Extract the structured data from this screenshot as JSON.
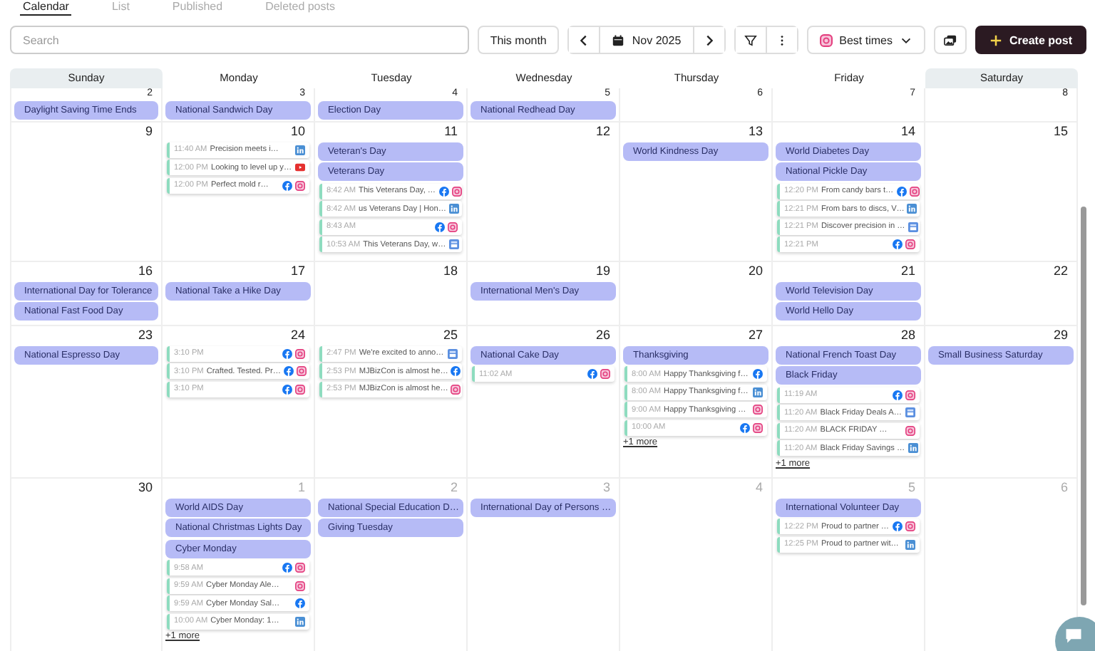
{
  "tabs": [
    {
      "label": "Calendar",
      "selected": true
    },
    {
      "label": "List",
      "selected": false
    },
    {
      "label": "Published",
      "selected": false
    },
    {
      "label": "Deleted posts",
      "selected": false
    }
  ],
  "toolbar": {
    "search": {
      "placeholder": "Search"
    },
    "this_month": "This month",
    "month": "Nov 2025",
    "best_times": "Best times",
    "create_post": "Create post"
  },
  "weekdays": [
    {
      "label": "Sunday",
      "weekend": true
    },
    {
      "label": "Monday",
      "weekend": false
    },
    {
      "label": "Tuesday",
      "weekend": false
    },
    {
      "label": "Wednesday",
      "weekend": false
    },
    {
      "label": "Thursday",
      "weekend": false
    },
    {
      "label": "Friday",
      "weekend": false
    },
    {
      "label": "Saturday",
      "weekend": true
    }
  ],
  "weeks": [
    {
      "days": [
        {
          "date": "2",
          "muted": false,
          "events": [
            "Daylight Saving Time Ends"
          ]
        },
        {
          "date": "3",
          "muted": false,
          "events": [
            "National Sandwich Day"
          ]
        },
        {
          "date": "4",
          "muted": false,
          "events": [
            "Election Day"
          ]
        },
        {
          "date": "5",
          "muted": false,
          "events": [
            "National Redhead Day"
          ]
        },
        {
          "date": "6",
          "muted": false
        },
        {
          "date": "7",
          "muted": false
        },
        {
          "date": "8",
          "muted": false
        }
      ]
    },
    {
      "days": [
        {
          "date": "9",
          "muted": false
        },
        {
          "date": "10",
          "muted": false,
          "posts": [
            {
              "time": "11:40 AM",
              "text": "Precision meets i…",
              "networks": [
                {
                  "kind": "linkedin"
                }
              ]
            },
            {
              "time": "12:00 PM",
              "text": "Looking to level up y…",
              "networks": [
                {
                  "kind": "youtube"
                }
              ]
            },
            {
              "time": "12:00 PM",
              "text": "Perfect mold r…",
              "networks": [
                {
                  "kind": "facebook"
                },
                {
                  "kind": "instagram"
                }
              ]
            }
          ]
        },
        {
          "date": "11",
          "muted": false,
          "events": [
            "Veteran's Day",
            "Veterans Day"
          ],
          "posts": [
            {
              "time": "8:42 AM",
              "text": "This Veterans Day, …",
              "networks": [
                {
                  "kind": "facebook"
                },
                {
                  "kind": "instagram"
                }
              ]
            },
            {
              "time": "8:42 AM",
              "text": "us Veterans Day | Hon…",
              "networks": [
                {
                  "kind": "linkedin"
                }
              ]
            },
            {
              "time": "8:43 AM",
              "networks": [
                {
                  "kind": "facebook"
                },
                {
                  "kind": "instagram"
                }
              ]
            },
            {
              "time": "10:53 AM",
              "text": "This Veterans Day, w…",
              "networks": [
                {
                  "kind": "business"
                }
              ]
            }
          ]
        },
        {
          "date": "12",
          "muted": false
        },
        {
          "date": "13",
          "muted": false,
          "events": [
            "World Kindness Day"
          ]
        },
        {
          "date": "14",
          "muted": false,
          "events": [
            "World Diabetes Day",
            "National Pickle Day"
          ],
          "posts": [
            {
              "time": "12:20 PM",
              "text": "From candy bars t…",
              "networks": [
                {
                  "kind": "facebook"
                },
                {
                  "kind": "instagram"
                }
              ]
            },
            {
              "time": "12:21 PM",
              "text": "From bars to discs, V…",
              "networks": [
                {
                  "kind": "linkedin"
                }
              ]
            },
            {
              "time": "12:21 PM",
              "text": "Discover precision in …",
              "networks": [
                {
                  "kind": "business"
                }
              ]
            },
            {
              "time": "12:21 PM",
              "networks": [
                {
                  "kind": "facebook"
                },
                {
                  "kind": "instagram"
                }
              ]
            }
          ]
        },
        {
          "date": "15",
          "muted": false
        }
      ]
    },
    {
      "days": [
        {
          "date": "16",
          "muted": false,
          "events": [
            "International Day for Tolerance",
            "National Fast Food Day"
          ]
        },
        {
          "date": "17",
          "muted": false,
          "events": [
            "National Take a Hike Day"
          ]
        },
        {
          "date": "18",
          "muted": false
        },
        {
          "date": "19",
          "muted": false,
          "events": [
            "International Men's Day"
          ]
        },
        {
          "date": "20",
          "muted": false
        },
        {
          "date": "21",
          "muted": false,
          "events": [
            "World Television Day",
            "World Hello Day"
          ]
        },
        {
          "date": "22",
          "muted": false
        }
      ]
    },
    {
      "days": [
        {
          "date": "23",
          "muted": false,
          "events": [
            "National Espresso Day"
          ]
        },
        {
          "date": "24",
          "muted": false,
          "posts": [
            {
              "time": "3:10 PM",
              "networks": [
                {
                  "kind": "facebook"
                },
                {
                  "kind": "instagram"
                }
              ]
            },
            {
              "time": "3:10 PM",
              "text": "Crafted. Tested. Pr…",
              "networks": [
                {
                  "kind": "facebook"
                },
                {
                  "kind": "instagram"
                }
              ]
            },
            {
              "time": "3:10 PM",
              "networks": [
                {
                  "kind": "facebook"
                },
                {
                  "kind": "instagram"
                }
              ]
            }
          ]
        },
        {
          "date": "25",
          "muted": false,
          "posts": [
            {
              "time": "2:47 PM",
              "text": "We're excited to anno…",
              "networks": [
                {
                  "kind": "business"
                }
              ]
            },
            {
              "time": "2:53 PM",
              "text": "MJBizCon is almost he…",
              "networks": [
                {
                  "kind": "facebook"
                }
              ]
            },
            {
              "time": "2:53 PM",
              "text": "MJBizCon is almost he…",
              "networks": [
                {
                  "kind": "instagram"
                }
              ]
            }
          ]
        },
        {
          "date": "26",
          "muted": false,
          "events": [
            "National Cake Day"
          ],
          "posts": [
            {
              "time": "11:02 AM",
              "networks": [
                {
                  "kind": "facebook"
                },
                {
                  "kind": "instagram"
                }
              ]
            }
          ]
        },
        {
          "date": "27",
          "muted": false,
          "events": [
            "Thanksgiving"
          ],
          "posts": [
            {
              "time": "8:00 AM",
              "text": "Happy Thanksgiving f…",
              "networks": [
                {
                  "kind": "facebook"
                }
              ]
            },
            {
              "time": "8:00 AM",
              "text": "Happy Thanksgiving f…",
              "networks": [
                {
                  "kind": "linkedin"
                }
              ]
            },
            {
              "time": "9:00 AM",
              "text": "Happy Thanksgiving …",
              "networks": [
                {
                  "kind": "instagram"
                }
              ]
            },
            {
              "time": "10:00 AM",
              "networks": [
                {
                  "kind": "facebook"
                },
                {
                  "kind": "instagram"
                }
              ]
            }
          ],
          "more": "+1 more"
        },
        {
          "date": "28",
          "muted": false,
          "events": [
            "National French Toast Day",
            "Black Friday"
          ],
          "posts": [
            {
              "time": "11:19 AM",
              "networks": [
                {
                  "kind": "facebook"
                },
                {
                  "kind": "instagram"
                }
              ]
            },
            {
              "time": "11:20 AM",
              "text": "Black Friday Deals A…",
              "networks": [
                {
                  "kind": "business"
                }
              ]
            },
            {
              "time": "11:20 AM",
              "text": "BLACK FRIDAY …",
              "networks": [
                {
                  "kind": "instagram"
                }
              ]
            },
            {
              "time": "11:20 AM",
              "text": "Black Friday Savings …",
              "networks": [
                {
                  "kind": "linkedin"
                }
              ]
            }
          ],
          "more": "+1 more"
        },
        {
          "date": "29",
          "muted": false,
          "events": [
            "Small Business Saturday"
          ]
        }
      ]
    },
    {
      "days": [
        {
          "date": "30",
          "muted": false
        },
        {
          "date": "1",
          "muted": true,
          "events": [
            "World AIDS Day",
            "National Christmas Lights Day",
            "Cyber Monday"
          ],
          "posts": [
            {
              "time": "9:58 AM",
              "networks": [
                {
                  "kind": "facebook"
                },
                {
                  "kind": "instagram"
                }
              ]
            },
            {
              "time": "9:59 AM",
              "text": "Cyber Monday Ale…",
              "networks": [
                {
                  "kind": "instagram"
                }
              ]
            },
            {
              "time": "9:59 AM",
              "text": "Cyber Monday Sal…",
              "networks": [
                {
                  "kind": "facebook"
                }
              ]
            },
            {
              "time": "10:00 AM",
              "text": "Cyber Monday: 1…",
              "networks": [
                {
                  "kind": "linkedin"
                }
              ]
            }
          ],
          "more": "+1 more"
        },
        {
          "date": "2",
          "muted": true,
          "events": [
            "National Special Education D…",
            "Giving Tuesday"
          ]
        },
        {
          "date": "3",
          "muted": true,
          "events": [
            "International Day of Persons …"
          ]
        },
        {
          "date": "4",
          "muted": true
        },
        {
          "date": "5",
          "muted": true,
          "events": [
            "International Volunteer Day"
          ],
          "posts": [
            {
              "time": "12:22 PM",
              "text": "Proud to partner …",
              "networks": [
                {
                  "kind": "facebook"
                },
                {
                  "kind": "instagram"
                }
              ]
            },
            {
              "time": "12:25 PM",
              "text": "Proud to partner wit…",
              "networks": [
                {
                  "kind": "linkedin"
                }
              ]
            }
          ]
        },
        {
          "date": "6",
          "muted": true
        }
      ]
    }
  ]
}
